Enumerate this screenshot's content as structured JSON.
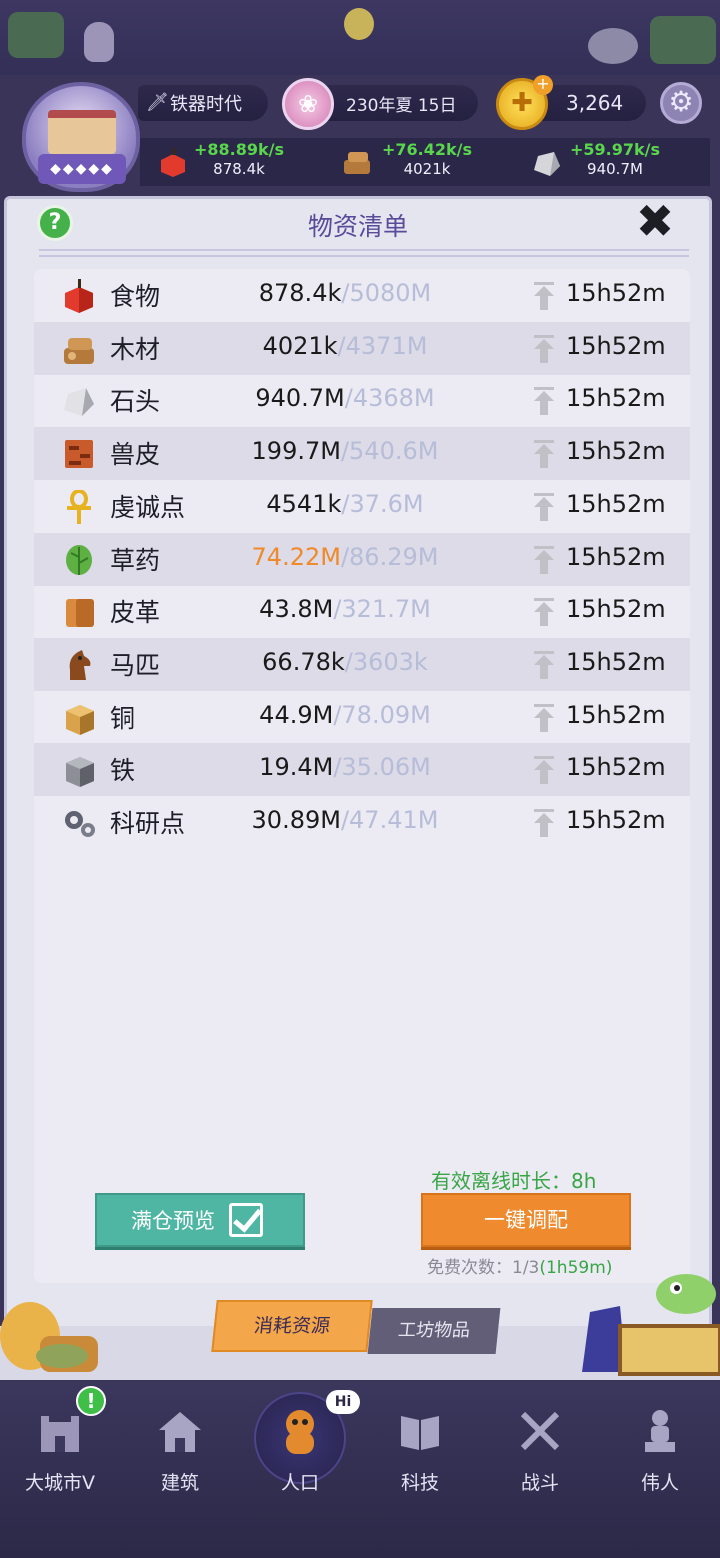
{
  "header": {
    "era": "铁器时代",
    "date": "230年夏 15日",
    "coins": "3,264",
    "production": [
      {
        "name": "food",
        "rate": "+88.89k/s",
        "amount": "878.4k"
      },
      {
        "name": "wood",
        "rate": "+76.42k/s",
        "amount": "4021k"
      },
      {
        "name": "stone",
        "rate": "+59.97k/s",
        "amount": "940.7M"
      }
    ]
  },
  "panel": {
    "title": "物资清单",
    "help_label": "?",
    "close_label": "✖",
    "rows": [
      {
        "name": "食物",
        "current": "878.4k",
        "capacity": "/5080M",
        "time": "15h52m",
        "icon": "apple-icon",
        "warn": false
      },
      {
        "name": "木材",
        "current": "4021k",
        "capacity": "/4371M",
        "time": "15h52m",
        "icon": "wood-icon",
        "warn": false
      },
      {
        "name": "石头",
        "current": "940.7M",
        "capacity": "/4368M",
        "time": "15h52m",
        "icon": "stone-icon",
        "warn": false
      },
      {
        "name": "兽皮",
        "current": "199.7M",
        "capacity": "/540.6M",
        "time": "15h52m",
        "icon": "hide-icon",
        "warn": false
      },
      {
        "name": "虔诚点",
        "current": "4541k",
        "capacity": "/37.6M",
        "time": "15h52m",
        "icon": "ankh-icon",
        "warn": false
      },
      {
        "name": "草药",
        "current": "74.22M",
        "capacity": "/86.29M",
        "time": "15h52m",
        "icon": "herb-icon",
        "warn": true
      },
      {
        "name": "皮革",
        "current": "43.8M",
        "capacity": "/321.7M",
        "time": "15h52m",
        "icon": "leather-icon",
        "warn": false
      },
      {
        "name": "马匹",
        "current": "66.78k",
        "capacity": "/3603k",
        "time": "15h52m",
        "icon": "horse-icon",
        "warn": false
      },
      {
        "name": "铜",
        "current": "44.9M",
        "capacity": "/78.09M",
        "time": "15h52m",
        "icon": "copper-icon",
        "warn": false
      },
      {
        "name": "铁",
        "current": "19.4M",
        "capacity": "/35.06M",
        "time": "15h52m",
        "icon": "iron-icon",
        "warn": false
      },
      {
        "name": "科研点",
        "current": "30.89M",
        "capacity": "/47.41M",
        "time": "15h52m",
        "icon": "gears-icon",
        "warn": false
      }
    ],
    "offline_label": "有效离线时长：8h",
    "full_preview_label": "满仓预览",
    "distribute_label": "一键调配",
    "free_count_label": "免费次数：1/3",
    "free_count_timer": "(1h59m)"
  },
  "tabs": {
    "consume": "消耗资源",
    "workshop": "工坊物品"
  },
  "nav": [
    {
      "label": "大城市V",
      "icon": "city-icon"
    },
    {
      "label": "建筑",
      "icon": "house-icon"
    },
    {
      "label": "人口",
      "icon": "person-icon"
    },
    {
      "label": "科技",
      "icon": "book-icon"
    },
    {
      "label": "战斗",
      "icon": "swords-icon"
    },
    {
      "label": "伟人",
      "icon": "statue-icon"
    }
  ],
  "badges": {
    "alert": "!",
    "hi": "Hi"
  },
  "colors": {
    "warn": "#ef8a2b",
    "capacity": "#b7bdd8",
    "green": "#38a546",
    "accent_orange": "#f08a2e",
    "accent_teal": "#4fb6a4"
  }
}
